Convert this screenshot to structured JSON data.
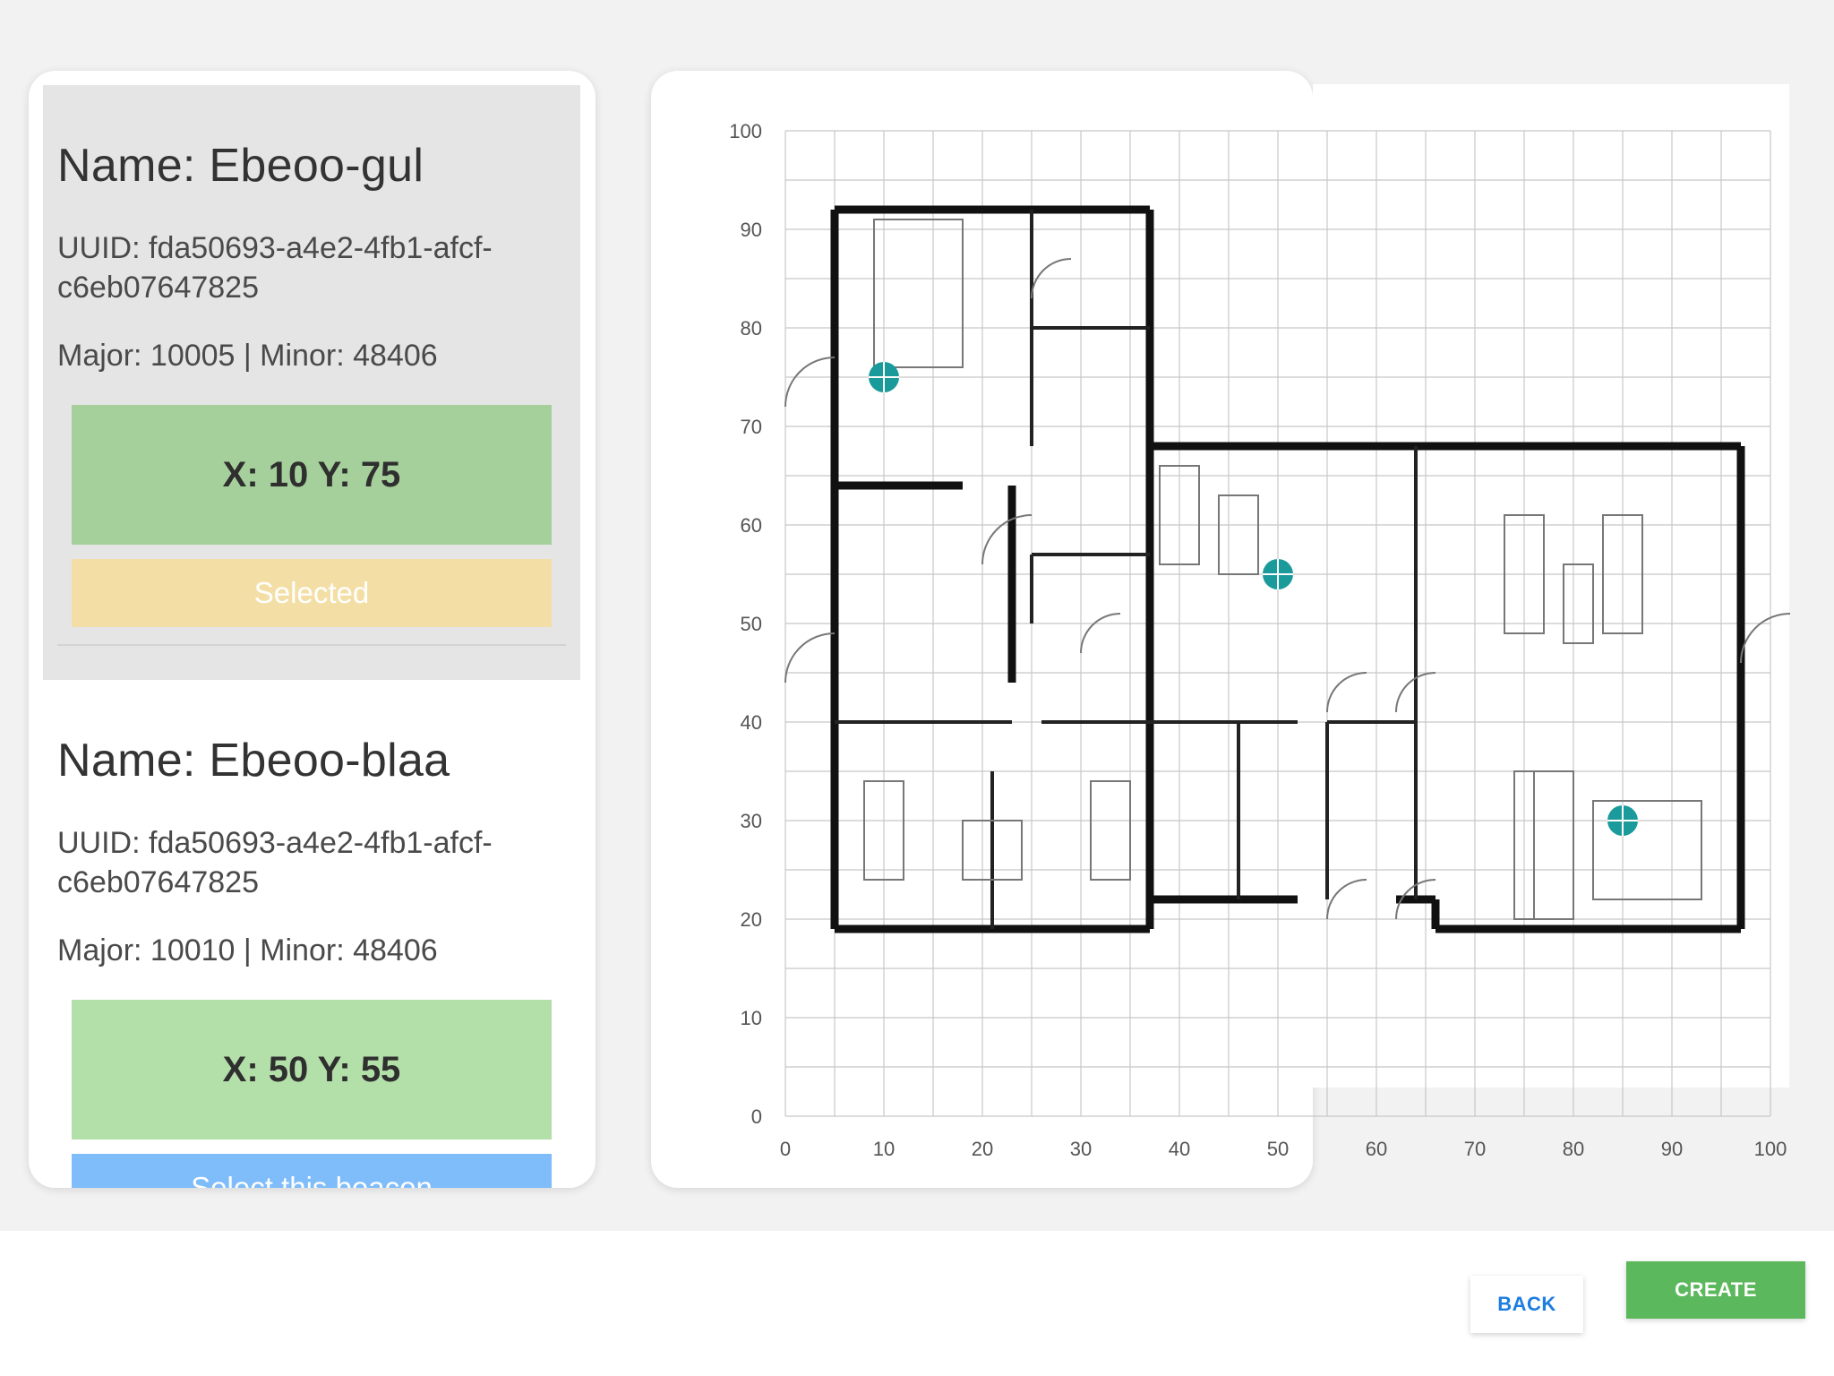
{
  "beacons": [
    {
      "name": "Name: Ebeoo-gul",
      "uuid_line1": "UUID: fda50693-a4e2-4fb1-afcf-",
      "uuid_line2": "c6eb07647825",
      "major_minor": "Major: 10005 | Minor: 48406",
      "coords": "X: 10 Y: 75",
      "x": 10,
      "y": 75,
      "action": "Selected",
      "selected": true
    },
    {
      "name": "Name: Ebeoo-blaa",
      "uuid_line1": "UUID: fda50693-a4e2-4fb1-afcf-",
      "uuid_line2": "c6eb07647825",
      "major_minor": "Major: 10010 | Minor: 48406",
      "coords": "X: 50 Y: 55",
      "x": 50,
      "y": 55,
      "action": "Select this beacon",
      "selected": false
    }
  ],
  "map": {
    "x_ticks": [
      "0",
      "10",
      "20",
      "30",
      "40",
      "50",
      "60",
      "70",
      "80",
      "90",
      "100"
    ],
    "y_ticks": [
      "0",
      "10",
      "20",
      "30",
      "40",
      "50",
      "60",
      "70",
      "80",
      "90",
      "100"
    ],
    "markers": [
      {
        "x": 10,
        "y": 75
      },
      {
        "x": 50,
        "y": 55
      },
      {
        "x": 85,
        "y": 30
      }
    ],
    "marker_color": "#1a9a9a"
  },
  "colors": {
    "selected_coord_bg": "#a6d09b",
    "coord_bg": "#b3dfa9",
    "selected_btn_bg": "#f3dfa6",
    "select_btn_bg": "#7fbcfa",
    "create_bg": "#5cb85c",
    "back_text": "#1d7de0"
  },
  "footer": {
    "back_label": "BACK",
    "create_label": "CREATE"
  }
}
